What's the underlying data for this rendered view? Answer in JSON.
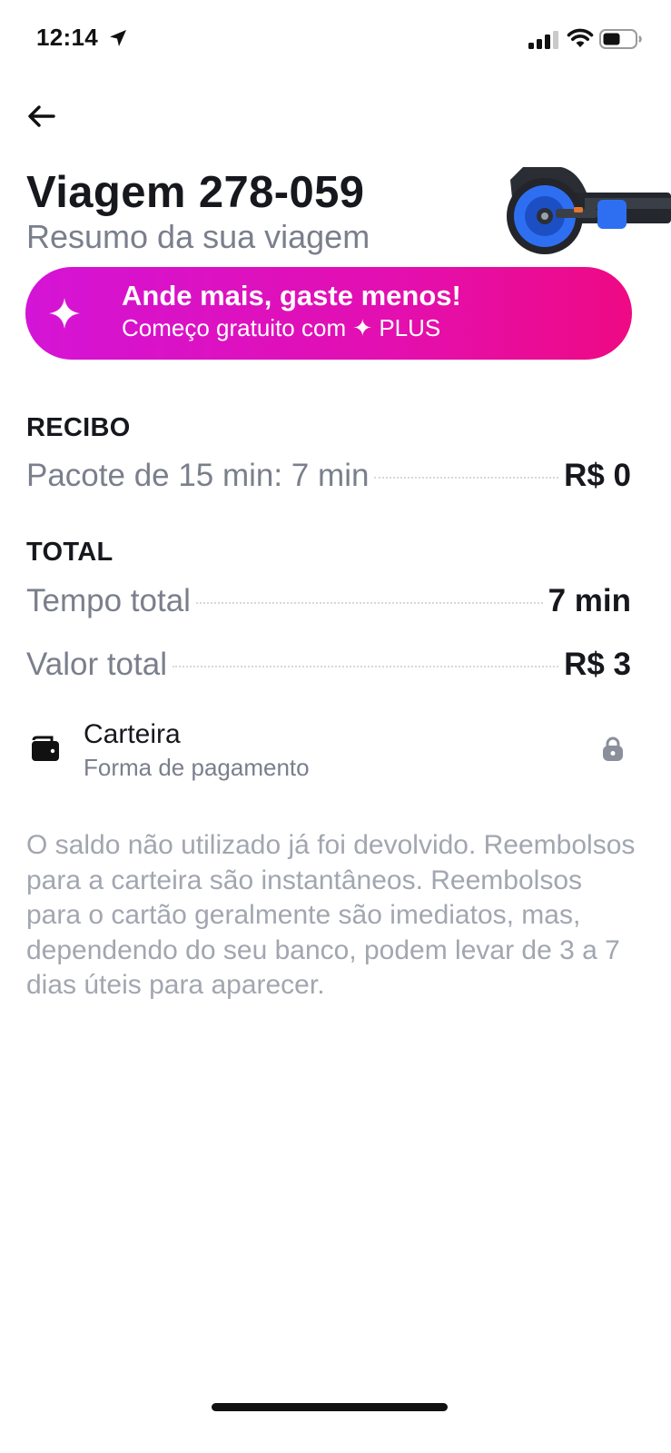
{
  "status_bar": {
    "time": "12:14",
    "icons": [
      "location-arrow-icon",
      "cellular-signal-icon",
      "wifi-icon",
      "battery-icon"
    ]
  },
  "header": {
    "title": "Viagem 278-059",
    "subtitle": "Resumo da sua viagem",
    "back_icon": "arrow-left-icon"
  },
  "promo": {
    "title": "Ande mais, gaste menos!",
    "subtitle": "Começo gratuito com ✦ PLUS",
    "icon": "sparkle-icon",
    "colors": {
      "start": "#d414d6",
      "end": "#ee0a84"
    }
  },
  "receipt": {
    "heading": "RECIBO",
    "items": [
      {
        "label": "Pacote de 15 min: 7 min",
        "value": "R$ 0"
      }
    ]
  },
  "total": {
    "heading": "TOTAL",
    "items": [
      {
        "label": "Tempo total",
        "value": "7 min"
      },
      {
        "label": "Valor total",
        "value": "R$ 3"
      }
    ]
  },
  "payment": {
    "title": "Carteira",
    "subtitle": "Forma de pagamento",
    "icon": "wallet-icon",
    "trailing_icon": "lock-icon"
  },
  "note": "O saldo não utilizado já foi devolvido. Reembolsos para a carteira são instantâneos. Reembolsos para o cartão geralmente são imediatos, mas, dependendo do seu banco, podem levar de 3 a 7 dias úteis para aparecer."
}
